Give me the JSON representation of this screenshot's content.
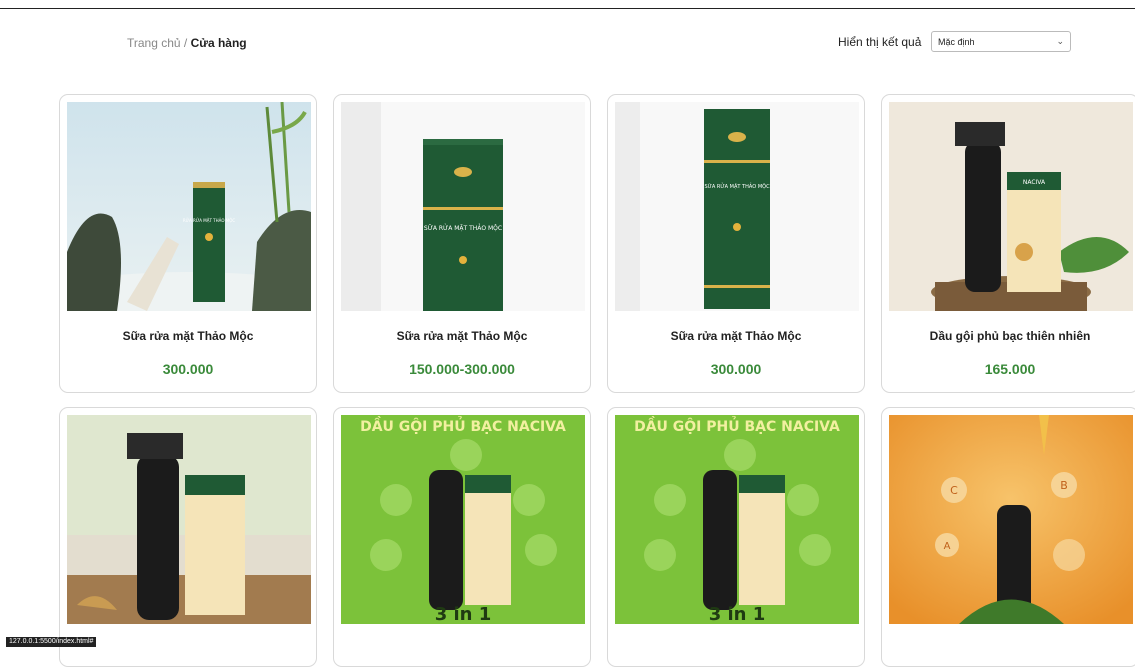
{
  "breadcrumb": {
    "home": "Trang chủ",
    "separator": " / ",
    "current": "Cửa hàng"
  },
  "sort": {
    "label": "Hiển thị kết quả",
    "selected": "Mặc định"
  },
  "products_row1": [
    {
      "name": "Sữa rửa mặt Thảo Mộc",
      "price": "300.000",
      "box_text": "RỬA RỬA MẶT THẢO MỘC"
    },
    {
      "name": "Sữa rửa mặt Thảo Mộc",
      "price": "150.000-300.000",
      "box_text": "SỮA RỬA MẶT THẢO MỘC"
    },
    {
      "name": "Sữa rửa mặt Thảo Mộc",
      "price": "300.000",
      "box_text": "SỮA RỬA MẶT THẢO MỘC"
    },
    {
      "name": "Dầu gội phủ bạc thiên nhiên",
      "price": "165.000",
      "box_text": "NACIVA"
    }
  ],
  "products_row2": [
    {
      "banner": ""
    },
    {
      "banner": "DẦU GỘI PHỦ BẠC NACIVA",
      "tagline": "3 in 1"
    },
    {
      "banner": "DẦU GỘI PHỦ BẠC NACIVA",
      "tagline": "3 in 1"
    },
    {
      "badges": [
        "C",
        "B",
        "A"
      ]
    }
  ],
  "colors": {
    "price": "#3a8a3a",
    "box_green": "#1f5a34",
    "banner_green": "#7cc23a",
    "orange": "#f2a23c"
  },
  "status_url": "127.0.0.1:5500/index.html#"
}
